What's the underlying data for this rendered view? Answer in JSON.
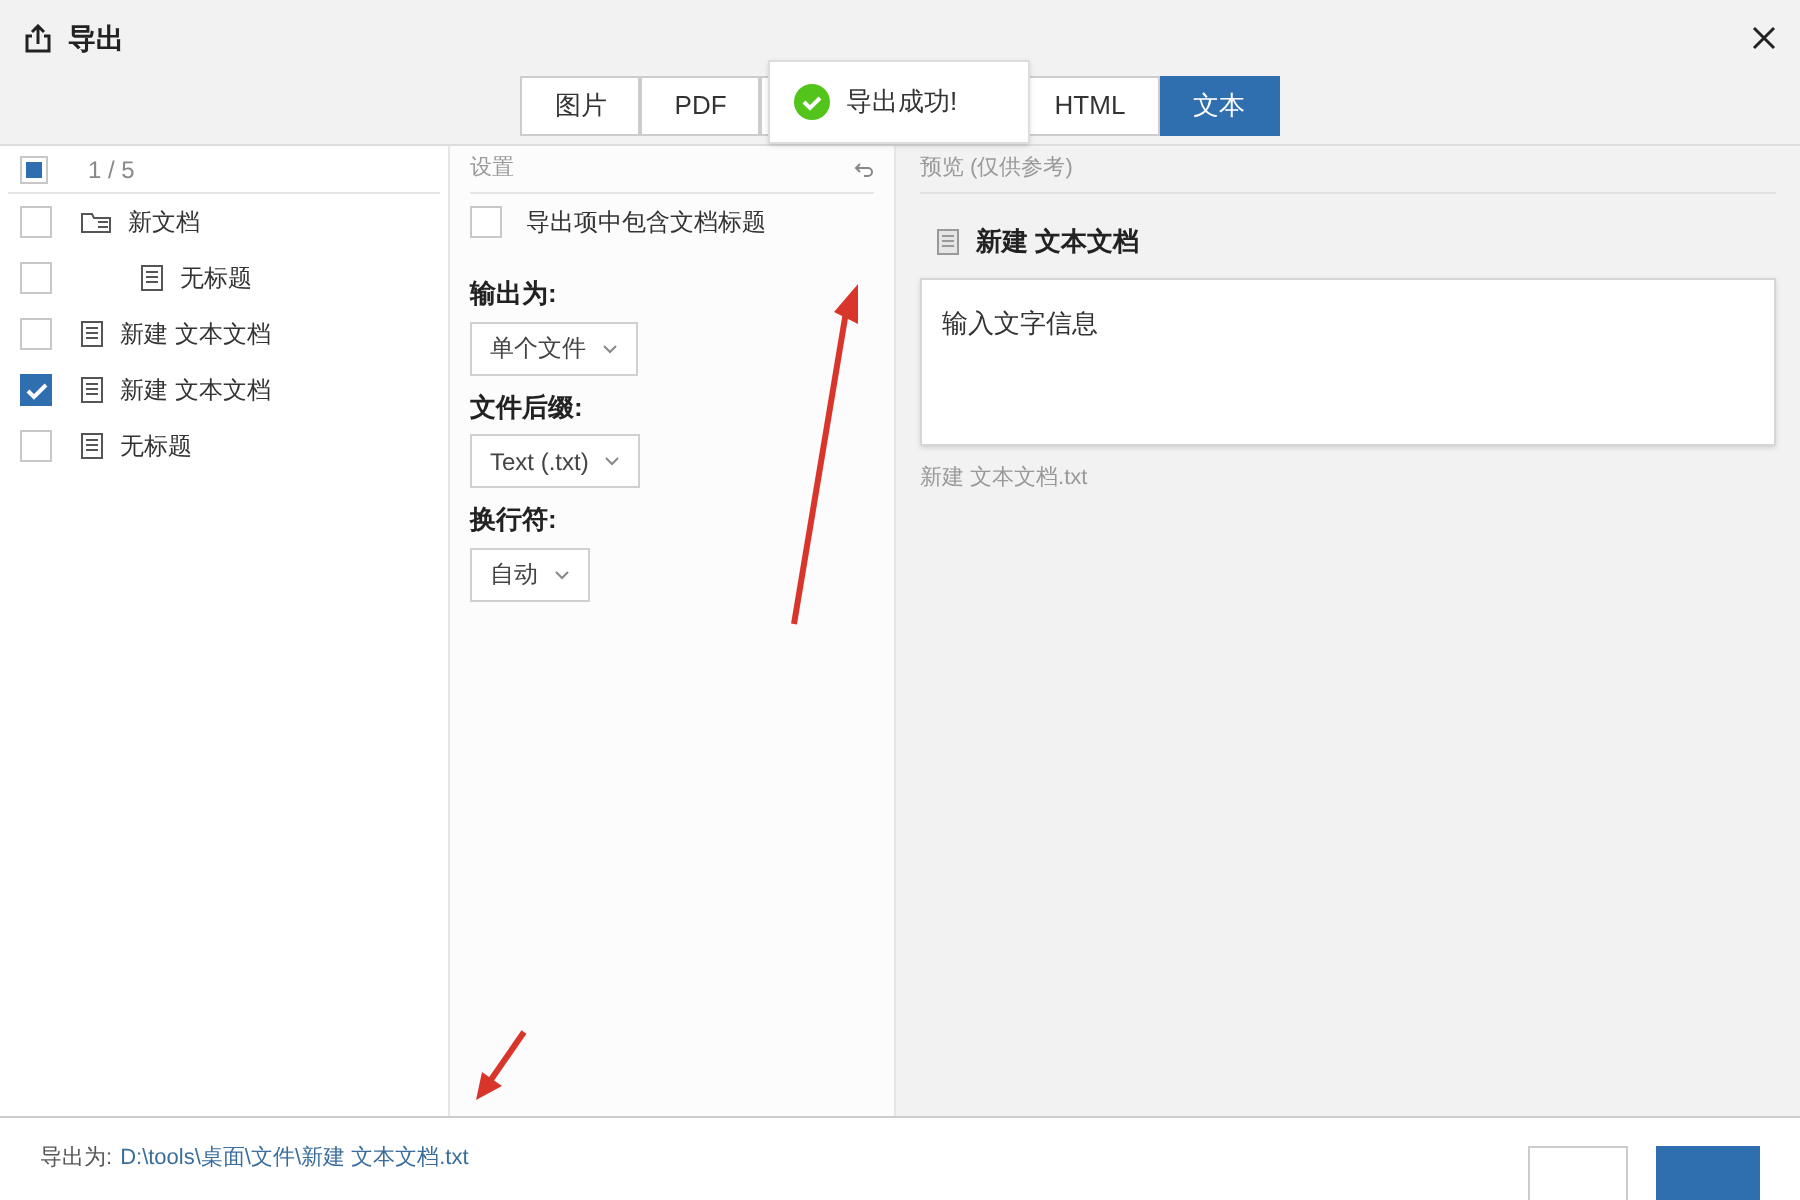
{
  "window": {
    "title": "导出"
  },
  "tabs": [
    {
      "label": "图片",
      "selected": false
    },
    {
      "label": "PDF",
      "selected": false
    },
    {
      "label": "HTML",
      "selected": false
    },
    {
      "label": "文本",
      "selected": true
    }
  ],
  "toast": {
    "message": "导出成功!"
  },
  "tree": {
    "header": {
      "count": "1 / 5",
      "partial": true
    },
    "items": [
      {
        "label": "新文档",
        "kind": "folder",
        "checked": false,
        "children": [
          {
            "label": "无标题",
            "kind": "doc",
            "checked": false
          }
        ]
      },
      {
        "label": "新建 文本文档",
        "kind": "doc",
        "checked": false
      },
      {
        "label": "新建 文本文档",
        "kind": "doc",
        "checked": true
      },
      {
        "label": "无标题",
        "kind": "doc",
        "checked": false
      }
    ]
  },
  "settings": {
    "title": "设置",
    "include_title": {
      "label": "导出项中包含文档标题",
      "checked": false
    },
    "fields": [
      {
        "label": "输出为:",
        "value": "单个文件"
      },
      {
        "label": "文件后缀:",
        "value": "Text (.txt)"
      },
      {
        "label": "换行符:",
        "value": "自动"
      }
    ]
  },
  "preview": {
    "title": "预览 (仅供参考)",
    "doc_title": "新建 文本文档",
    "content": "输入文字信息",
    "filename": "新建 文本文档.txt"
  },
  "footer": {
    "label": "导出为:",
    "path": "D:\\tools\\桌面\\文件\\新建 文本文档.txt"
  }
}
